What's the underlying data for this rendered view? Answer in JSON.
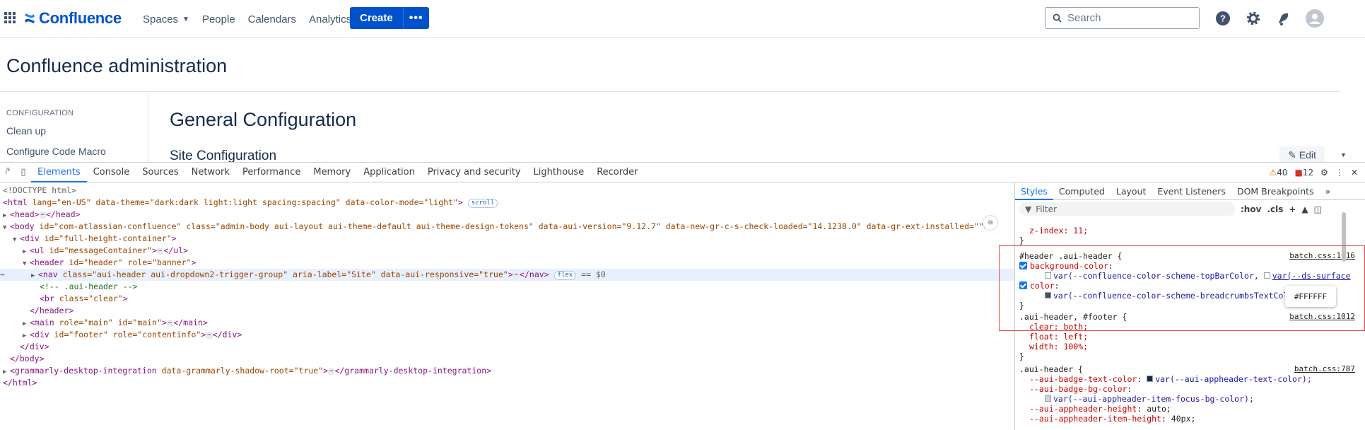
{
  "app": {
    "name": "Confluence"
  },
  "nav": [
    {
      "label": "Spaces",
      "dropdown": true
    },
    {
      "label": "People"
    },
    {
      "label": "Calendars"
    },
    {
      "label": "Analytics"
    }
  ],
  "create": {
    "label": "Create",
    "more": "•••"
  },
  "search": {
    "placeholder": "Search"
  },
  "page": {
    "admin_title": "Confluence administration",
    "sidebar_heading": "CONFIGURATION",
    "sidebar_links": [
      "Clean up",
      "Configure Code Macro"
    ],
    "main_title": "General Configuration",
    "sub_title": "Site Configuration",
    "edit_label": "Edit"
  },
  "devtools": {
    "tabs": [
      "Elements",
      "Console",
      "Sources",
      "Network",
      "Performance",
      "Memory",
      "Application",
      "Privacy and security",
      "Lighthouse",
      "Recorder"
    ],
    "active_tab": "Elements",
    "warnings": "40",
    "errors": "12",
    "dom": {
      "doctype": "<!DOCTYPE html>",
      "html_open_attrs": " lang=\"en-US\" data-theme=\"dark:dark light:light spacing:spacing\" data-color-mode=\"light\"",
      "scroll_badge": "scroll",
      "head": "head",
      "body_attrs": " id=\"com-atlassian-confluence\" class=\"admin-body aui-layout aui-theme-default aui-theme-design-tokens\" data-aui-version=\"9.12.7\" data-new-gr-c-s-check-loaded=\"14.1238.0\" data-gr-ext-installed=\"\"",
      "div_full": " id=\"full-height-container\"",
      "ul_msg": " id=\"messageContainer\"",
      "header_attrs": " id=\"header\" role=\"banner\"",
      "nav_attrs": " class=\"aui-header aui-dropdown2-trigger-group\" aria-label=\"Site\" data-aui-responsive=\"true\"",
      "flex_badge": "flex",
      "dollar0": "== $0",
      "comment": "<!-- .aui-header -->",
      "br_attrs": " class=\"clear\"",
      "main_attrs": " role=\"main\" id=\"main\"",
      "footer_attrs": " id=\"footer\" role=\"contentinfo\"",
      "grammarly_attrs": " data-grammarly-shadow-root=\"true\""
    },
    "styles_tabs": [
      "Styles",
      "Computed",
      "Layout",
      "Event Listeners",
      "DOM Breakpoints"
    ],
    "filter_placeholder": "Filter",
    "filter_tools": [
      ":hov",
      ".cls"
    ],
    "rules": {
      "r0_prop": "z-index: 11;",
      "r1_selector": "#header .aui-header {",
      "r1_link": "batch.css:1016",
      "r1_p1": "background-color",
      "r1_v1a": "var(--confluence-color-scheme-topBarColor,",
      "r1_v1b": "var(--ds-surface",
      "r1_p2": "color",
      "r1_v2": "var(--confluence-color-scheme-breadcrumbsTextColor",
      "tooltip": "#FFFFFF",
      "r2_selector": ".aui-header, #footer {",
      "r2_link": "batch.css:1012",
      "r2_props": [
        "clear: both;",
        "float: left;",
        "width: 100%;"
      ],
      "r3_selector": ".aui-header {",
      "r3_link": "batch.css:787",
      "r3_p1": "--aui-badge-text-color",
      "r3_v1": "var(--aui-appheader-text-color);",
      "r3_p2": "--aui-badge-bg-color",
      "r3_v2": "var(--aui-appheader-item-focus-bg-color);",
      "r3_p3": "--aui-appheader-height",
      "r3_v3": "auto;",
      "r3_p4": "--aui-appheader-item-height",
      "r3_v4": "40px;"
    }
  },
  "colors": {
    "brand": "#0052cc",
    "devtools_accent": "#1a73e8",
    "highlight": "#e5484d"
  }
}
